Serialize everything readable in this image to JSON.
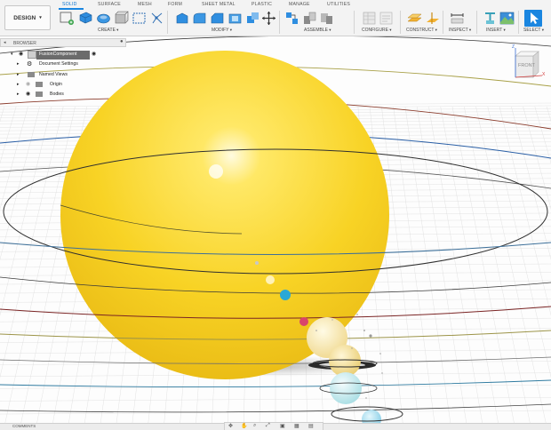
{
  "workspace_button": "DESIGN",
  "tabs": [
    "SOLID",
    "SURFACE",
    "MESH",
    "FORM",
    "SHEET METAL",
    "PLASTIC",
    "MANAGE",
    "UTILITIES"
  ],
  "groups": [
    "CREATE",
    "MODIFY",
    "ASSEMBLE",
    "CONFIGURE",
    "CONSTRUCT",
    "INSPECT",
    "INSERT",
    "SELECT"
  ],
  "browser": {
    "title": "BROWSER",
    "items": [
      "FusionComponent",
      "Document Settings",
      "Named Views",
      "Origin",
      "Bodies"
    ]
  },
  "viewcube": {
    "face": "FRONT",
    "axis_x": "X",
    "axis_z": "Z"
  },
  "comments_label": "COMMENTS",
  "colors": {
    "accent": "#1a86e0",
    "sun": "#f7d21a",
    "earth": "#2aa8d6",
    "mars": "#d9456b",
    "uranus": "#a9e0e4",
    "neptune": "#8fd4ea",
    "saturn": "#efd98a"
  }
}
